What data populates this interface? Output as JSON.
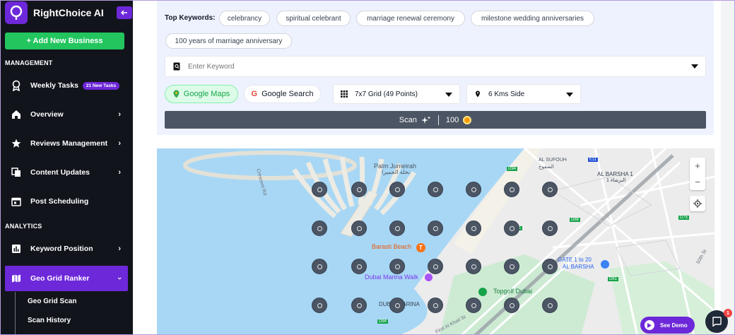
{
  "app": {
    "name": "RightChoice AI"
  },
  "sidebar": {
    "add_button": "+ Add New Business",
    "sections": {
      "management": "MANAGEMENT",
      "analytics": "ANALYTICS"
    },
    "items": [
      {
        "label": "Weekly Tasks",
        "badge": "21 New Tasks",
        "icon": "award-icon"
      },
      {
        "label": "Overview",
        "icon": "home-icon"
      },
      {
        "label": "Reviews Management",
        "icon": "star-icon"
      },
      {
        "label": "Content Updates",
        "icon": "copy-icon"
      },
      {
        "label": "Post Scheduling",
        "icon": "calendar-icon"
      },
      {
        "label": "Keyword Position",
        "icon": "bar-chart-icon"
      },
      {
        "label": "Geo Grid Ranker",
        "icon": "map-icon",
        "active": true
      }
    ],
    "subitems": [
      "Geo Grid Scan",
      "Scan History"
    ]
  },
  "keywords": {
    "label": "Top Keywords:",
    "chips": [
      "celebrancy",
      "spiritual celebrant",
      "marriage renewal ceremony",
      "milestone wedding anniversaries",
      "100 years of marriage anniversary"
    ]
  },
  "keyword_input": {
    "placeholder": "Enter Keyword",
    "value": ""
  },
  "source_toggle": {
    "google_maps": "Google Maps",
    "google_search": "Google Search",
    "selected": "Google Maps"
  },
  "grid_select": {
    "value": "7x7 Grid (49 Points)"
  },
  "distance_select": {
    "value": "6 Kms Side"
  },
  "scan": {
    "label": "Scan",
    "cost": "100"
  },
  "map": {
    "labels": {
      "palm": "Palm Jumeirah",
      "palm_ar": "نخلة الجميرا",
      "crescent": "Crescent Rd",
      "al_sufouh": "AL SUFOUH",
      "al_sufouh_ar": "الصفوح",
      "al_barsha": "AL BARSHA 1",
      "al_barsha_ar": "البرشاء 1",
      "barasti": "Barasti Beach",
      "marina_walk": "Dubai Marina Walk",
      "gate": "GATE 1 to 20",
      "al_barsha2": "AL BARSHA",
      "topgolf": "Topgolf Dubai",
      "marina": "DUBAI MARINA",
      "khail": "First Al Khail St",
      "road_50": "50th St",
      "d94": "D94",
      "d94b": "D94",
      "d86": "D86",
      "d61": "D61",
      "d61b": "D61",
      "d75": "D75",
      "e11": "E11"
    },
    "zoom_in": "+",
    "zoom_out": "−"
  },
  "see_demo": {
    "label": "See Demo"
  },
  "chat": {
    "badge": "1"
  },
  "colors": {
    "accent": "#6d28d9",
    "add": "#22c55e",
    "sidebar": "#12141c",
    "water": "#aadaff",
    "land": "#e9ecef"
  }
}
